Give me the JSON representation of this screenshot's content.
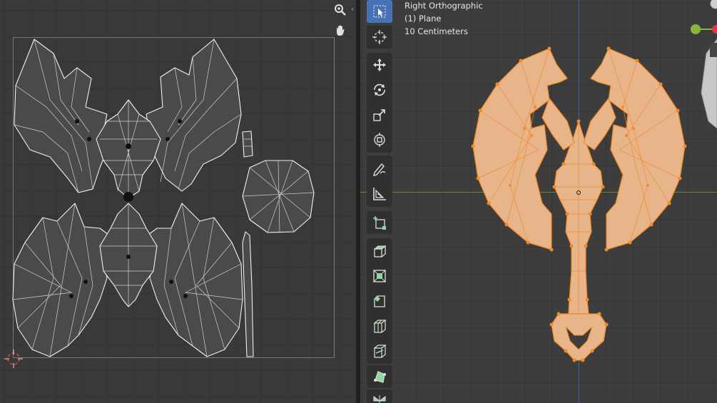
{
  "viewport": {
    "view_name": "Right Orthographic",
    "object_name": "(1) Plane",
    "scale_text": "10 Centimeters"
  },
  "uv_editor": {
    "nav_icons": [
      "zoom-icon",
      "hand-pan-icon"
    ],
    "collapse_glyph": "‹"
  },
  "toolbar": {
    "tools": [
      "select-box-icon",
      "cursor-icon",
      "move-icon",
      "rotate-icon",
      "scale-icon",
      "transform-icon",
      "annotate-icon",
      "measure-icon",
      "add-cube-icon",
      "extrude-icon",
      "inset-icon",
      "bevel-icon",
      "loop-cut-icon",
      "knife-icon",
      "poly-build-icon",
      "spin-icon"
    ],
    "active_tool": "select-box-icon"
  },
  "colors": {
    "selection_orange": "#f08a24",
    "mesh_fill": "#e8b48a",
    "active_tool_blue": "#4772b3",
    "x_axis_green": "#6a8f2e",
    "z_axis_blue": "#3d63a6"
  }
}
